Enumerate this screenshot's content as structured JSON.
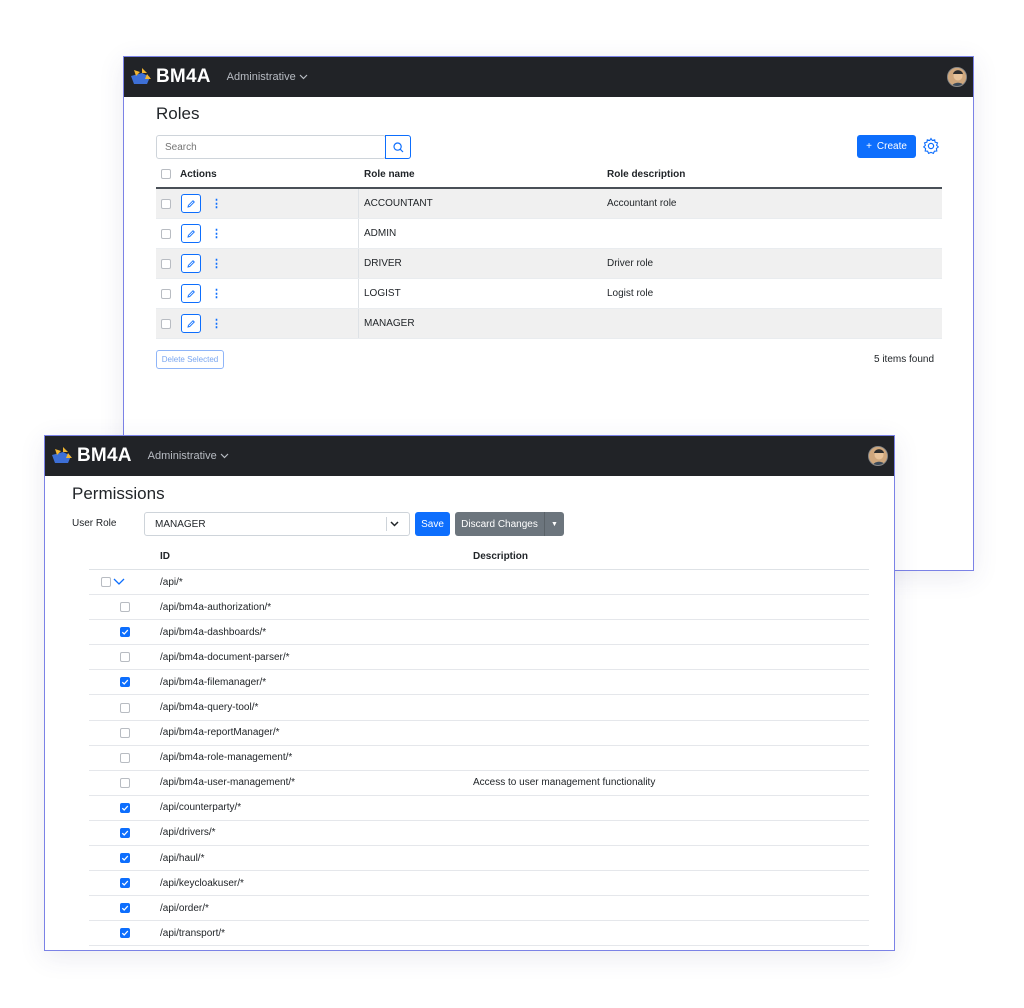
{
  "app": {
    "brand": "BM4A",
    "nav_menu": "Administrative"
  },
  "roles_page": {
    "title": "Roles",
    "search_placeholder": "Search",
    "create_label": "Create",
    "columns": {
      "actions": "Actions",
      "role_name": "Role name",
      "role_description": "Role description"
    },
    "rows": [
      {
        "name": "ACCOUNTANT",
        "description": "Accountant role"
      },
      {
        "name": "ADMIN",
        "description": ""
      },
      {
        "name": "DRIVER",
        "description": "Driver role"
      },
      {
        "name": "LOGIST",
        "description": "Logist role"
      },
      {
        "name": "MANAGER",
        "description": ""
      }
    ],
    "delete_selected_label": "Delete Selected",
    "items_found": "5 items found"
  },
  "permissions_page": {
    "title": "Permissions",
    "user_role_label": "User Role",
    "selected_role": "MANAGER",
    "save_label": "Save",
    "discard_label": "Discard Changes",
    "columns": {
      "id": "ID",
      "description": "Description"
    },
    "root": {
      "id": "/api/*",
      "checked": false,
      "expanded": true
    },
    "rows": [
      {
        "id": "/api/bm4a-authorization/*",
        "description": "",
        "checked": false
      },
      {
        "id": "/api/bm4a-dashboards/*",
        "description": "",
        "checked": true
      },
      {
        "id": "/api/bm4a-document-parser/*",
        "description": "",
        "checked": false
      },
      {
        "id": "/api/bm4a-filemanager/*",
        "description": "",
        "checked": true
      },
      {
        "id": "/api/bm4a-query-tool/*",
        "description": "",
        "checked": false
      },
      {
        "id": "/api/bm4a-reportManager/*",
        "description": "",
        "checked": false
      },
      {
        "id": "/api/bm4a-role-management/*",
        "description": "",
        "checked": false
      },
      {
        "id": "/api/bm4a-user-management/*",
        "description": "Access to user management functionality",
        "checked": false
      },
      {
        "id": "/api/counterparty/*",
        "description": "",
        "checked": true
      },
      {
        "id": "/api/drivers/*",
        "description": "",
        "checked": true
      },
      {
        "id": "/api/haul/*",
        "description": "",
        "checked": true
      },
      {
        "id": "/api/keycloakuser/*",
        "description": "",
        "checked": true
      },
      {
        "id": "/api/order/*",
        "description": "",
        "checked": true
      },
      {
        "id": "/api/transport/*",
        "description": "",
        "checked": true
      }
    ]
  },
  "colors": {
    "accent": "#0d6efd",
    "topbar": "#212327",
    "window_border": "#7b82e6",
    "secondary": "#6c757d"
  }
}
